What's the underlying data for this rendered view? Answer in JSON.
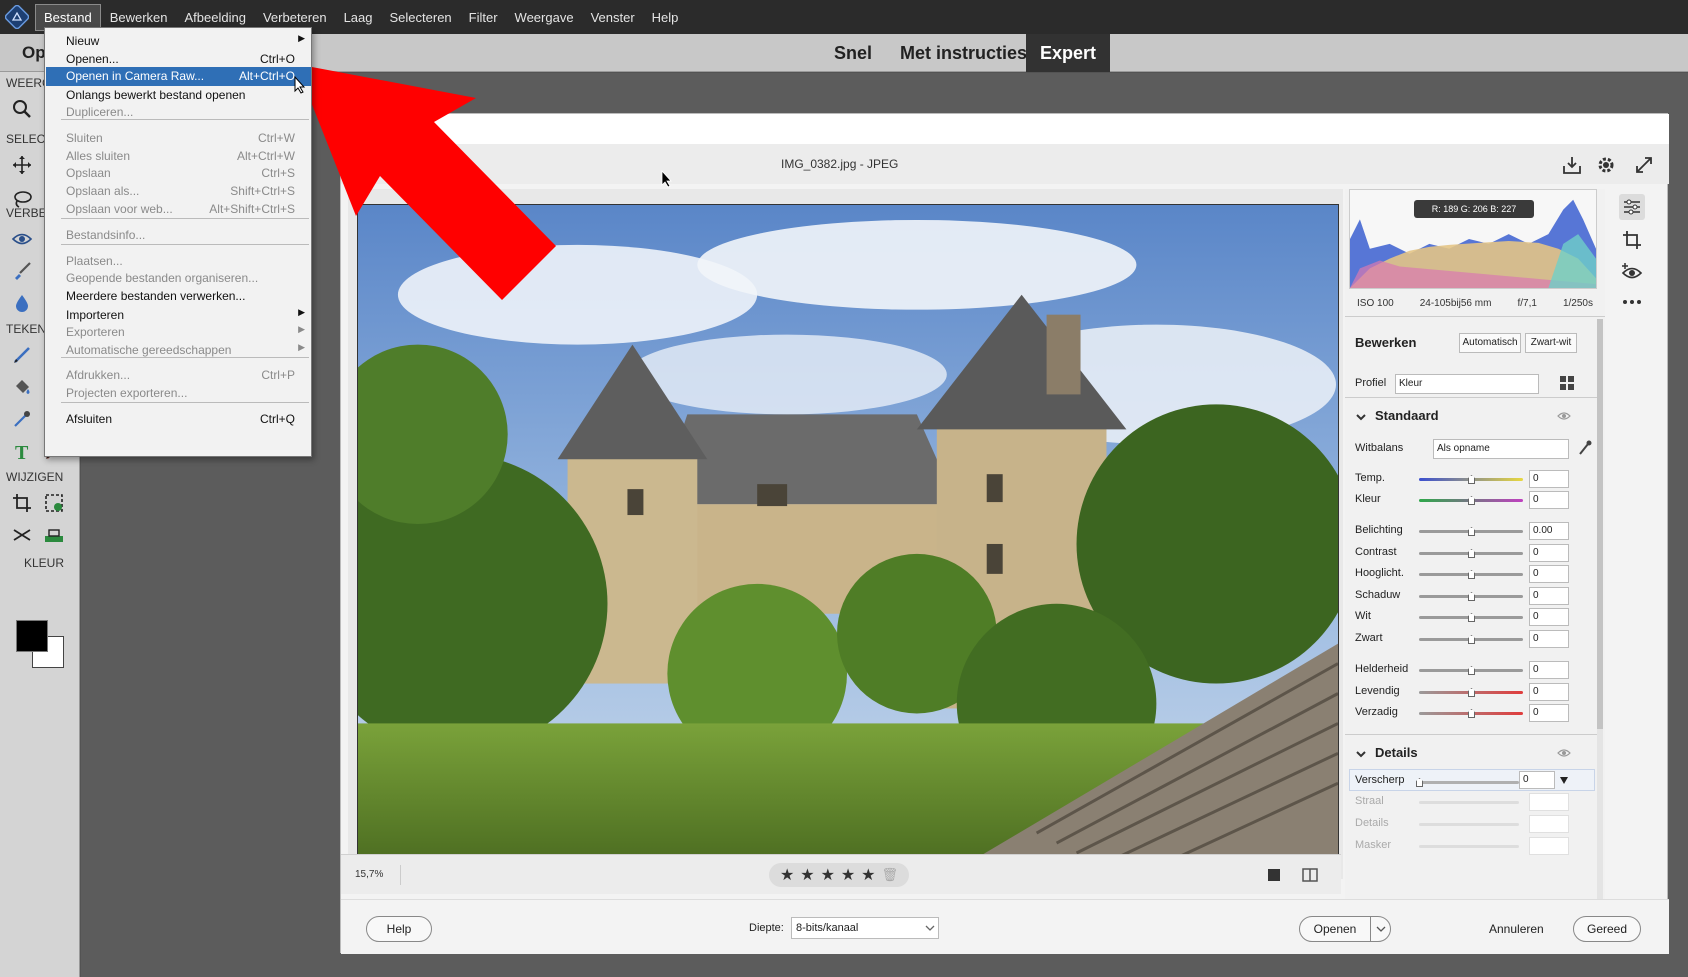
{
  "menubar": {
    "items": [
      "Bestand",
      "Bewerken",
      "Afbeelding",
      "Verbeteren",
      "Laag",
      "Selecteren",
      "Filter",
      "Weergave",
      "Venster",
      "Help"
    ],
    "active_index": 0
  },
  "modebar": {
    "open_label": "Op",
    "tabs": [
      "Snel",
      "Met instructies",
      "Expert"
    ],
    "active_tab": "Expert"
  },
  "toolbar": {
    "sections": {
      "view": "WEERG",
      "select": "SELECT",
      "enhance": "VERBE",
      "draw": "TEKEN",
      "modify": "WIJZIGEN",
      "color": "KLEUR"
    },
    "icons": [
      "zoom-icon",
      "move-icon",
      "lasso-icon",
      "eye-icon",
      "brush-icon",
      "drop-icon",
      "pencil-icon",
      "bucket-icon",
      "eyedropper-icon",
      "type-icon",
      "pen-icon",
      "crop-icon",
      "recompose-icon",
      "straighten-icon",
      "shapes-icon"
    ]
  },
  "file_menu": {
    "items": [
      {
        "label": "Nieuw",
        "shortcut": "",
        "submenu": true,
        "disabled": false,
        "highlighted": false
      },
      {
        "label": "Openen...",
        "shortcut": "Ctrl+O",
        "submenu": false,
        "disabled": false,
        "highlighted": false
      },
      {
        "label": "Openen in Camera Raw...",
        "shortcut": "Alt+Ctrl+O",
        "submenu": false,
        "disabled": false,
        "highlighted": true
      },
      {
        "label": "Onlangs bewerkt bestand openen",
        "shortcut": "",
        "submenu": false,
        "disabled": false,
        "highlighted": false
      },
      {
        "label": "Dupliceren...",
        "shortcut": "",
        "submenu": false,
        "disabled": true,
        "highlighted": false
      },
      {
        "label": "Sluiten",
        "shortcut": "Ctrl+W",
        "submenu": false,
        "disabled": true,
        "highlighted": false
      },
      {
        "label": "Alles sluiten",
        "shortcut": "Alt+Ctrl+W",
        "submenu": false,
        "disabled": true,
        "highlighted": false
      },
      {
        "label": "Opslaan",
        "shortcut": "Ctrl+S",
        "submenu": false,
        "disabled": true,
        "highlighted": false
      },
      {
        "label": "Opslaan als...",
        "shortcut": "Shift+Ctrl+S",
        "submenu": false,
        "disabled": true,
        "highlighted": false
      },
      {
        "label": "Opslaan voor web...",
        "shortcut": "Alt+Shift+Ctrl+S",
        "submenu": false,
        "disabled": true,
        "highlighted": false
      },
      {
        "label": "Bestandsinfo...",
        "shortcut": "",
        "submenu": false,
        "disabled": true,
        "highlighted": false
      },
      {
        "label": "Plaatsen...",
        "shortcut": "",
        "submenu": false,
        "disabled": true,
        "highlighted": false
      },
      {
        "label": "Geopende bestanden organiseren...",
        "shortcut": "",
        "submenu": false,
        "disabled": true,
        "highlighted": false
      },
      {
        "label": "Meerdere bestanden verwerken...",
        "shortcut": "",
        "submenu": false,
        "disabled": false,
        "highlighted": false
      },
      {
        "label": "Importeren",
        "shortcut": "",
        "submenu": true,
        "disabled": false,
        "highlighted": false
      },
      {
        "label": "Exporteren",
        "shortcut": "",
        "submenu": true,
        "disabled": true,
        "highlighted": false
      },
      {
        "label": "Automatische gereedschappen",
        "shortcut": "",
        "submenu": true,
        "disabled": true,
        "highlighted": false
      },
      {
        "label": "Afdrukken...",
        "shortcut": "Ctrl+P",
        "submenu": false,
        "disabled": true,
        "highlighted": false
      },
      {
        "label": "Projecten exporteren...",
        "shortcut": "",
        "submenu": false,
        "disabled": true,
        "highlighted": false
      },
      {
        "label": "Afsluiten",
        "shortcut": "Ctrl+Q",
        "submenu": false,
        "disabled": false,
        "highlighted": false
      }
    ]
  },
  "raw": {
    "file_title": "IMG_0382.jpg  -  JPEG",
    "zoom": "15,7%",
    "stars": [
      "★",
      "★",
      "★",
      "★",
      "★"
    ],
    "trash": "🗑",
    "rgb": "R: 189   G: 206   B: 227",
    "exif": {
      "iso": "ISO 100",
      "lens": "24-105bij56 mm",
      "aperture": "f/7,1",
      "shutter": "1/250s"
    },
    "edit_title": "Bewerken",
    "auto_btn": "Automatisch",
    "bw_btn": "Zwart-wit",
    "profile_label": "Profiel",
    "profile_value": "Kleur",
    "standard_title": "Standaard",
    "wb_label": "Witbalans",
    "wb_value": "Als opname",
    "sliders": [
      {
        "label": "Temp.",
        "value": "0",
        "pos": 0.5
      },
      {
        "label": "Kleur",
        "value": "0",
        "pos": 0.5
      },
      {
        "label": "Belichting",
        "value": "0.00",
        "pos": 0.5
      },
      {
        "label": "Contrast",
        "value": "0",
        "pos": 0.5
      },
      {
        "label": "Hooglicht.",
        "value": "0",
        "pos": 0.5
      },
      {
        "label": "Schaduw",
        "value": "0",
        "pos": 0.5
      },
      {
        "label": "Wit",
        "value": "0",
        "pos": 0.5
      },
      {
        "label": "Zwart",
        "value": "0",
        "pos": 0.5
      },
      {
        "label": "Helderheid",
        "value": "0",
        "pos": 0.5
      },
      {
        "label": "Levendig",
        "value": "0",
        "pos": 0.5
      },
      {
        "label": "Verzadig",
        "value": "0",
        "pos": 0.5
      }
    ],
    "details_title": "Details",
    "sharpen_label": "Verscherp",
    "sharpen_value": "0",
    "detail_dim": [
      "Straal",
      "Details",
      "Masker"
    ],
    "help_btn": "Help",
    "depth_label": "Diepte:",
    "depth_value": "8-bits/kanaal",
    "open_btn": "Openen",
    "cancel_btn": "Annuleren",
    "done_btn": "Gereed"
  },
  "colors": {
    "accent_highlight": "#2f6fb6",
    "arrow": "#ff0000"
  }
}
